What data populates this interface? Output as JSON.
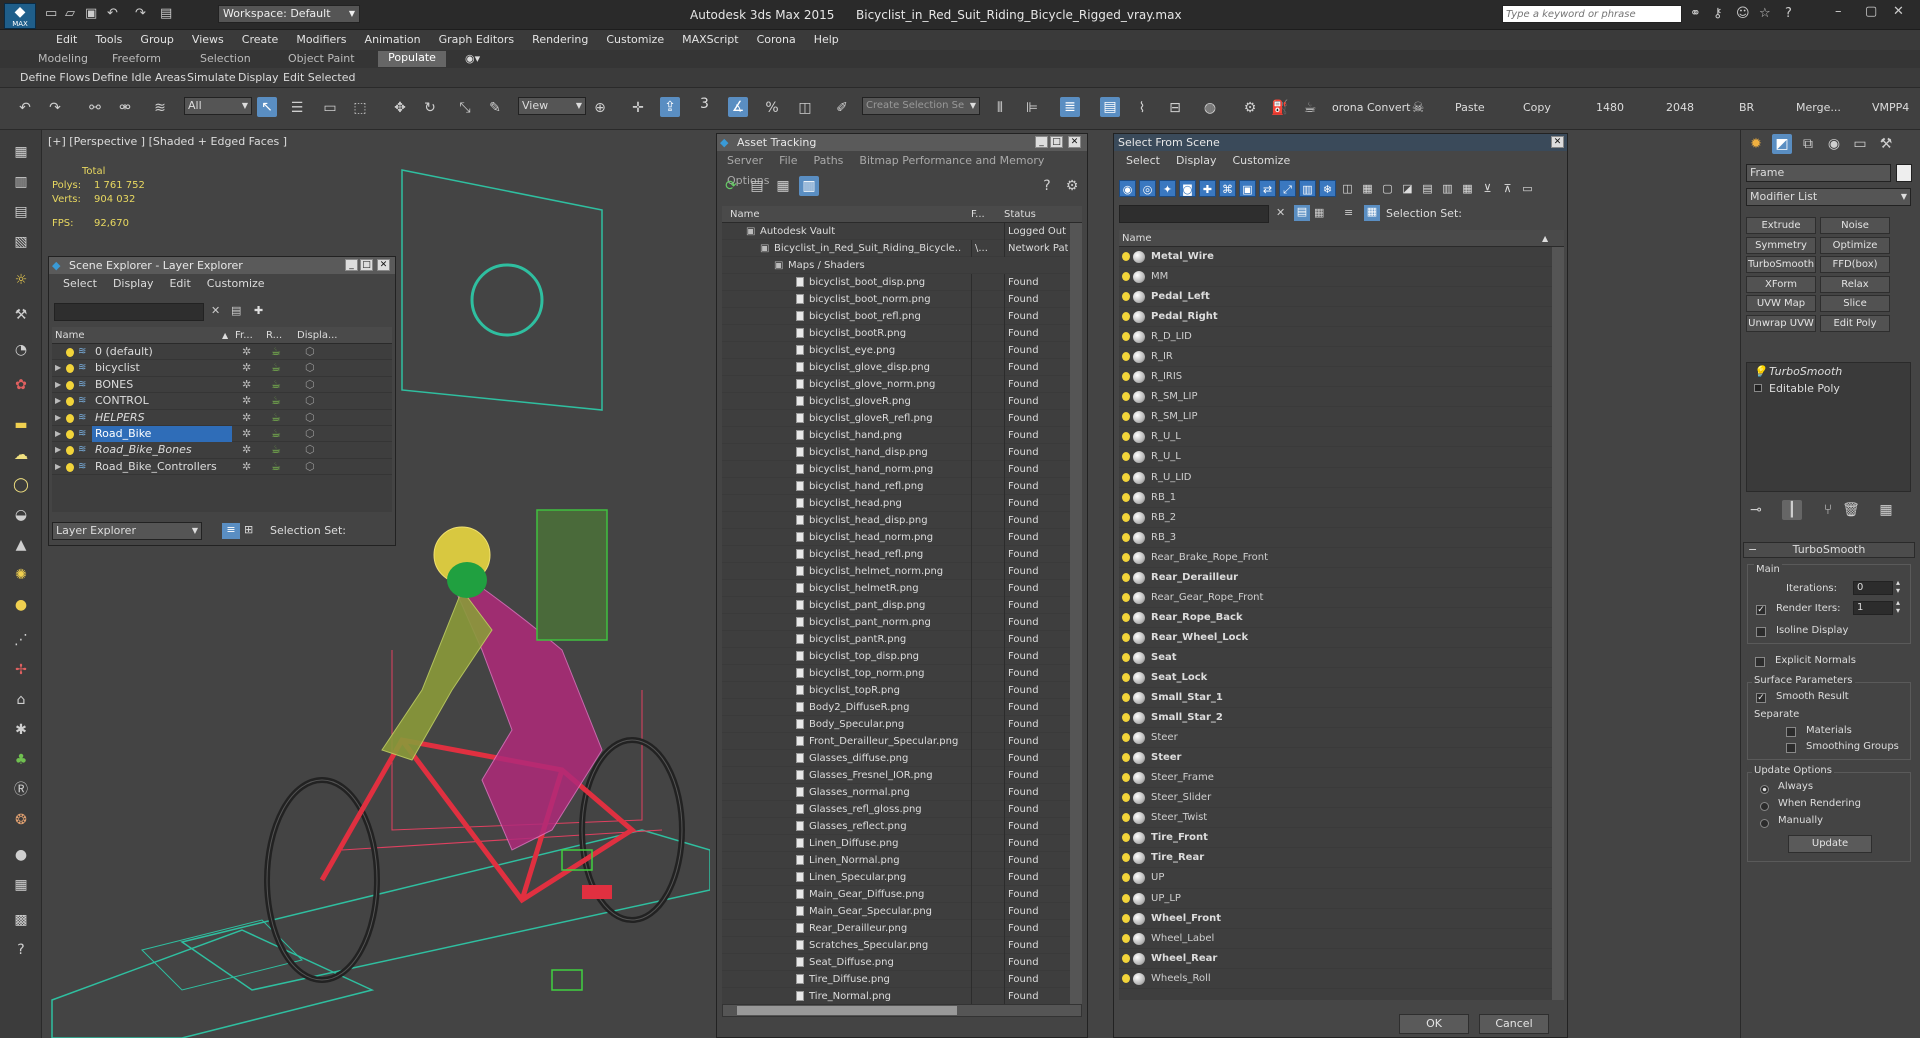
{
  "app": {
    "title": "Autodesk 3ds Max  2015",
    "file": "Bicyclist_in_Red_Suit_Riding_Bicycle_Rigged_vray.max",
    "workspace": "Workspace: Default",
    "search_placeholder": "Type a keyword or phrase",
    "logo": "MAX"
  },
  "menu": [
    "Edit",
    "Tools",
    "Group",
    "Views",
    "Create",
    "Modifiers",
    "Animation",
    "Graph Editors",
    "Rendering",
    "Customize",
    "MAXScript",
    "Corona",
    "Help"
  ],
  "ribbon_tabs": [
    "Modeling",
    "Freeform",
    "Selection",
    "Object Paint",
    "Populate"
  ],
  "subribbon": [
    "Define Flows",
    "Define Idle Areas",
    "Simulate",
    "Display",
    "Edit Selected"
  ],
  "toolbar": {
    "filter": "All",
    "view": "View",
    "snap_num": "3",
    "create_selection": "Create Selection Se",
    "right_labels": [
      "orona Convert",
      "Paste",
      "Copy",
      "1480",
      "2048",
      "BR",
      "Merge...",
      "VMPP4"
    ]
  },
  "viewport": {
    "label": "[+] [Perspective ] [Shaded + Edged Faces ]",
    "stats": {
      "total_label": "Total",
      "polys_label": "Polys:",
      "polys": "1 761 752",
      "verts_label": "Verts:",
      "verts": "904 032",
      "fps_label": "FPS:",
      "fps": "92,670"
    }
  },
  "scene_explorer": {
    "title": "Scene Explorer - Layer Explorer",
    "menu": [
      "Select",
      "Display",
      "Edit",
      "Customize"
    ],
    "columns": [
      "Name",
      "Fr...",
      "R...",
      "Displa..."
    ],
    "rows": [
      {
        "name": "0 (default)",
        "italic": false,
        "selected": false
      },
      {
        "name": "bicyclist",
        "italic": false,
        "selected": false
      },
      {
        "name": "BONES",
        "italic": false,
        "selected": false
      },
      {
        "name": "CONTROL",
        "italic": false,
        "selected": false
      },
      {
        "name": "HELPERS",
        "italic": true,
        "selected": false
      },
      {
        "name": "Road_Bike",
        "italic": false,
        "selected": true
      },
      {
        "name": "Road_Bike_Bones",
        "italic": true,
        "selected": false
      },
      {
        "name": "Road_Bike_Controllers",
        "italic": false,
        "selected": false
      }
    ],
    "footer_dropdown": "Layer Explorer",
    "footer_selection": "Selection Set:"
  },
  "asset_tracking": {
    "title": "Asset Tracking",
    "menu": [
      "Server",
      "File",
      "Paths",
      "Bitmap Performance and Memory",
      "Options"
    ],
    "columns": [
      "Name",
      "F...",
      "Status"
    ],
    "tree": [
      {
        "name": "Autodesk Vault",
        "f": "",
        "status": "Logged Out (",
        "indent": 1
      },
      {
        "name": "Bicyclist_in_Red_Suit_Riding_Bicycle...",
        "f": "\\...",
        "status": "Network Path",
        "indent": 2
      },
      {
        "name": "Maps / Shaders",
        "f": "",
        "status": "",
        "indent": 3
      }
    ],
    "files": [
      "bicyclist_boot_disp.png",
      "bicyclist_boot_norm.png",
      "bicyclist_boot_refl.png",
      "bicyclist_bootR.png",
      "bicyclist_eye.png",
      "bicyclist_glove_disp.png",
      "bicyclist_glove_norm.png",
      "bicyclist_gloveR.png",
      "bicyclist_gloveR_refl.png",
      "bicyclist_hand.png",
      "bicyclist_hand_disp.png",
      "bicyclist_hand_norm.png",
      "bicyclist_hand_refl.png",
      "bicyclist_head.png",
      "bicyclist_head_disp.png",
      "bicyclist_head_norm.png",
      "bicyclist_head_refl.png",
      "bicyclist_helmet_norm.png",
      "bicyclist_helmetR.png",
      "bicyclist_pant_disp.png",
      "bicyclist_pant_norm.png",
      "bicyclist_pantR.png",
      "bicyclist_top_disp.png",
      "bicyclist_top_norm.png",
      "bicyclist_topR.png",
      "Body2_DiffuseR.png",
      "Body_Specular.png",
      "Front_Derailleur_Specular.png",
      "Glasses_diffuse.png",
      "Glasses_Fresnel_IOR.png",
      "Glasses_normal.png",
      "Glasses_refl_gloss.png",
      "Glasses_reflect.png",
      "Linen_Diffuse.png",
      "Linen_Normal.png",
      "Linen_Specular.png",
      "Main_Gear_Diffuse.png",
      "Main_Gear_Specular.png",
      "Rear_Derailleur.png",
      "Scratches_Specular.png",
      "Seat_Diffuse.png",
      "Tire_Diffuse.png",
      "Tire_Normal.png"
    ],
    "found_label": "Found"
  },
  "select_from_scene": {
    "title": "Select From Scene",
    "menu": [
      "Select",
      "Display",
      "Customize"
    ],
    "selection_set": "Selection Set:",
    "column": "Name",
    "items": [
      {
        "name": "Metal_Wire",
        "bold": true
      },
      {
        "name": "MM",
        "bold": false
      },
      {
        "name": "Pedal_Left",
        "bold": true
      },
      {
        "name": "Pedal_Right",
        "bold": true
      },
      {
        "name": "R_D_LID",
        "bold": false
      },
      {
        "name": "R_IR",
        "bold": false
      },
      {
        "name": "R_IRIS",
        "bold": false
      },
      {
        "name": "R_SM_LIP",
        "bold": false
      },
      {
        "name": "R_SM_LIP",
        "bold": false
      },
      {
        "name": "R_U_L",
        "bold": false
      },
      {
        "name": "R_U_L",
        "bold": false
      },
      {
        "name": "R_U_LID",
        "bold": false
      },
      {
        "name": "RB_1",
        "bold": false
      },
      {
        "name": "RB_2",
        "bold": false
      },
      {
        "name": "RB_3",
        "bold": false
      },
      {
        "name": "Rear_Brake_Rope_Front",
        "bold": false
      },
      {
        "name": "Rear_Derailleur",
        "bold": true
      },
      {
        "name": "Rear_Gear_Rope_Front",
        "bold": false
      },
      {
        "name": "Rear_Rope_Back",
        "bold": true
      },
      {
        "name": "Rear_Wheel_Lock",
        "bold": true
      },
      {
        "name": "Seat",
        "bold": true
      },
      {
        "name": "Seat_Lock",
        "bold": true
      },
      {
        "name": "Small_Star_1",
        "bold": true
      },
      {
        "name": "Small_Star_2",
        "bold": true
      },
      {
        "name": "Steer",
        "bold": false
      },
      {
        "name": "Steer",
        "bold": true
      },
      {
        "name": "Steer_Frame",
        "bold": false
      },
      {
        "name": "Steer_Slider",
        "bold": false
      },
      {
        "name": "Steer_Twist",
        "bold": false
      },
      {
        "name": "Tire_Front",
        "bold": true
      },
      {
        "name": "Tire_Rear",
        "bold": true
      },
      {
        "name": "UP",
        "bold": false
      },
      {
        "name": "UP_LP",
        "bold": false
      },
      {
        "name": "Wheel_Front",
        "bold": true
      },
      {
        "name": "Wheel_Label",
        "bold": false
      },
      {
        "name": "Wheel_Rear",
        "bold": true
      },
      {
        "name": "Wheels_Roll",
        "bold": false
      }
    ],
    "ok": "OK",
    "cancel": "Cancel"
  },
  "command_panel": {
    "name_field": "Frame",
    "modifier_list": "Modifier List",
    "buttons": [
      "Extrude",
      "Noise",
      "Symmetry",
      "Optimize",
      "TurboSmooth",
      "FFD(box)",
      "XForm",
      "Relax",
      "UVW Map",
      "Slice",
      "Unwrap UVW",
      "Edit Poly"
    ],
    "stack": [
      "TurboSmooth",
      "Editable Poly"
    ],
    "rollout_title": "TurboSmooth",
    "main_label": "Main",
    "iterations_label": "Iterations:",
    "iterations": "0",
    "render_iters_label": "Render Iters:",
    "render_iters": "1",
    "isoline": "Isoline Display",
    "explicit_normals": "Explicit Normals",
    "surface_params": "Surface Parameters",
    "smooth_result": "Smooth Result",
    "separate": "Separate",
    "materials": "Materials",
    "smoothing_groups": "Smoothing Groups",
    "update_options": "Update Options",
    "always": "Always",
    "when_rendering": "When Rendering",
    "manually": "Manually",
    "update": "Update"
  }
}
